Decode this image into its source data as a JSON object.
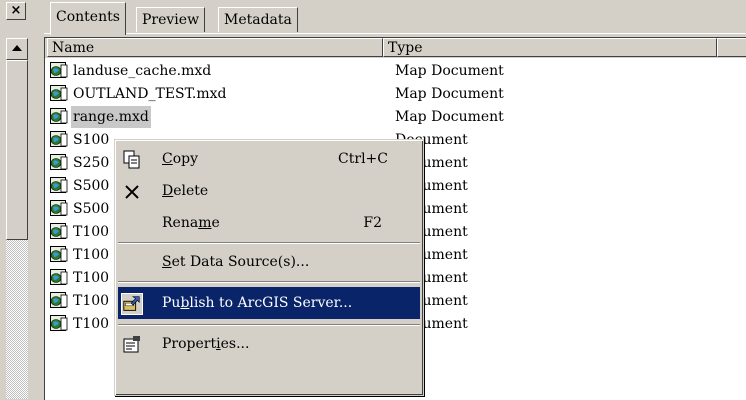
{
  "window": {
    "close_glyph": "×"
  },
  "tabs": [
    {
      "label": "Contents",
      "active": true
    },
    {
      "label": "Preview",
      "active": false
    },
    {
      "label": "Metadata",
      "active": false
    }
  ],
  "columns": {
    "name": "Name",
    "type": "Type"
  },
  "rows": [
    {
      "name": "landuse_cache.mxd",
      "type": "Map Document",
      "icon": "map-document-icon"
    },
    {
      "name": "OUTLAND_TEST.mxd",
      "type": "Map Document",
      "icon": "map-document-icon"
    },
    {
      "name": "range.mxd",
      "type": "Map Document",
      "icon": "map-document-icon",
      "selected": true
    },
    {
      "name": "S100",
      "type": "Document",
      "icon": "map-document-icon"
    },
    {
      "name": "S250",
      "type": "Document",
      "icon": "map-document-icon"
    },
    {
      "name": "S500",
      "type": "Document",
      "icon": "map-document-icon"
    },
    {
      "name": "S500",
      "type": "Document",
      "icon": "map-document-icon"
    },
    {
      "name": "T100",
      "type": "Document",
      "icon": "map-document-icon"
    },
    {
      "name": "T100",
      "type": "Document",
      "icon": "map-document-icon"
    },
    {
      "name": "T100",
      "type": "Document",
      "icon": "map-document-icon"
    },
    {
      "name": "T100",
      "type": "Document",
      "icon": "map-document-icon"
    },
    {
      "name": "T100",
      "type": "Document",
      "icon": "map-document-icon"
    }
  ],
  "context_menu": {
    "copy": {
      "pre": "",
      "key": "C",
      "post": "opy",
      "shortcut": "Ctrl+C",
      "icon": "copy-icon"
    },
    "delete": {
      "pre": "",
      "key": "D",
      "post": "elete",
      "icon": "delete-x-icon"
    },
    "rename": {
      "pre": "Rena",
      "key": "m",
      "post": "e",
      "shortcut": "F2"
    },
    "set_data_source": {
      "pre": "",
      "key": "S",
      "post": "et Data Source(s)..."
    },
    "publish": {
      "pre": "Pu",
      "key": "b",
      "post": "lish to ArcGIS Server...",
      "icon": "publish-server-icon",
      "highlighted": true
    },
    "properties": {
      "pre": "Propert",
      "key": "i",
      "post": "es...",
      "icon": "properties-icon"
    }
  },
  "colors": {
    "highlight": "#0a246a",
    "face": "#d4d0c8",
    "selected_row": "#c8c8c8"
  }
}
